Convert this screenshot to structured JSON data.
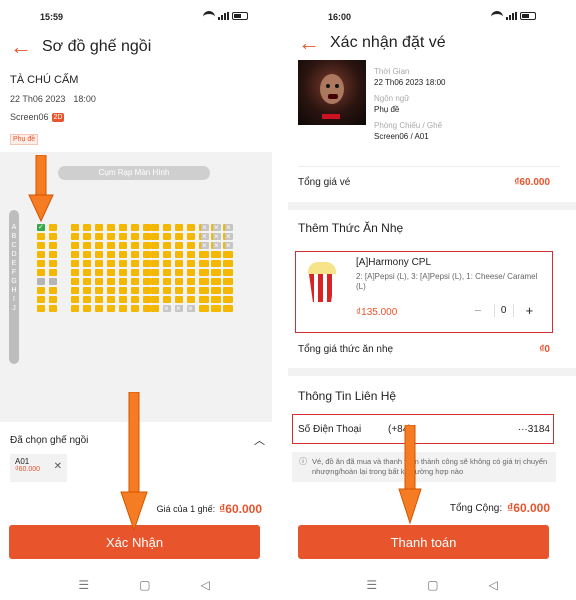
{
  "colors": {
    "accent": "#e8542c",
    "seat_available": "#f5b800",
    "seat_selected": "#3aa64a",
    "seat_taken": "#c6c6c6",
    "highlight_box": "#d32f2f"
  },
  "left": {
    "status_time": "15:59",
    "title": "Sơ đồ ghế ngồi",
    "cinema": "TÀ CHÚ CẤM",
    "date": "22 Th06 2023",
    "time": "18:00",
    "screen": "Screen06",
    "format_badge": "2D",
    "subtitle_tag": "Phụ đề",
    "screen_label": "Cụm Rạp Màn Hình",
    "rows": [
      "A",
      "B",
      "C",
      "D",
      "E",
      "F",
      "G",
      "H",
      "I",
      "J"
    ],
    "selected_title": "Đã chọn ghế ngồi",
    "selected_seat": "A01",
    "selected_price": "₫60.000",
    "price_label": "Giá của 1 ghế:",
    "price_value": "₫60.000",
    "confirm_button": "Xác Nhận"
  },
  "right": {
    "status_time": "16:00",
    "title": "Xác nhận đặt vé",
    "time_label": "Thời Gian",
    "time_value": "22 Th06 2023 18:00",
    "language_label": "Ngôn ngữ",
    "language_value": "Phụ đề",
    "room_label": "Phòng Chiếu / Ghế",
    "room_value": "Screen06 / A01",
    "ticket_total_label": "Tổng giá vé",
    "ticket_total_value": "₫60.000",
    "snack_section_title": "Thêm Thức Ăn Nhẹ",
    "combo_name": "[A]Harmony CPL",
    "combo_desc": "2: [A]Pepsi (L), 3: [A]Pepsi (L), 1: Cheese/ Caramel (L)",
    "combo_price": "₫135.000",
    "combo_qty": "0",
    "snack_total_label": "Tổng giá thức ăn nhẹ",
    "snack_total_value": "₫0",
    "contact_title": "Thông Tin Liên Hệ",
    "phone_label": "Số Điện Thoại",
    "phone_code": "(+84)",
    "phone_value": "···3184",
    "note": "Vé, đồ ăn đã mua và thanh toán thành công sẽ không có giá trị chuyển nhượng/hoàn lại trong bất kỳ trường hợp nào",
    "grand_total_label": "Tổng Cộng:",
    "grand_total_value": "₫60.000",
    "pay_button": "Thanh toán"
  }
}
